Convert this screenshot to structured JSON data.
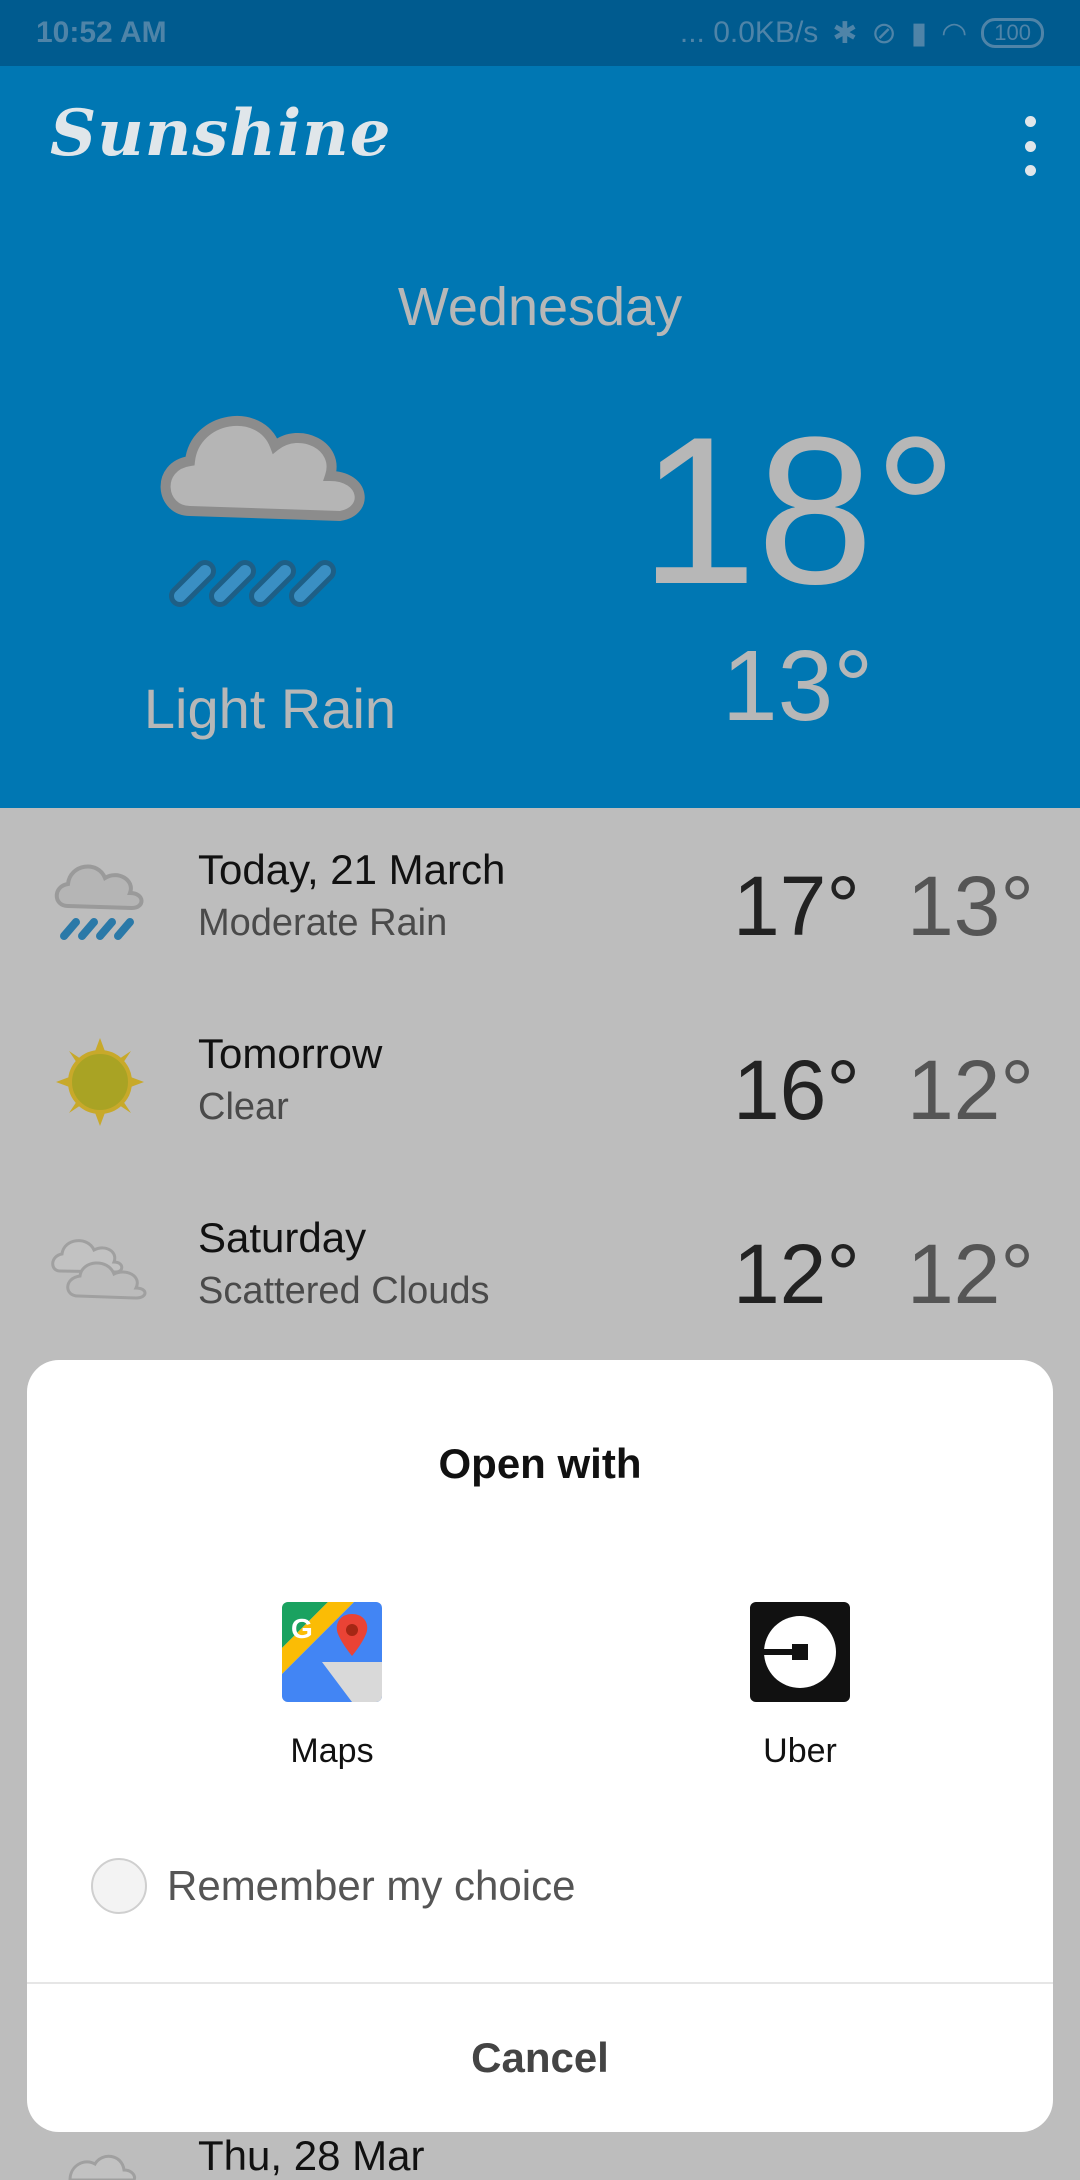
{
  "status_bar": {
    "time": "10:52 AM",
    "network": "... 0.0KB/s",
    "battery": "100"
  },
  "app": {
    "title": "Sunshine"
  },
  "today": {
    "day": "Wednesday",
    "condition": "Light Rain",
    "high": "18°",
    "low": "13°",
    "icon": "rain-cloud-icon"
  },
  "forecast": [
    {
      "date": "Today, 21 March",
      "desc": "Moderate Rain",
      "high": "17°",
      "low": "13°",
      "icon": "rain-cloud-icon"
    },
    {
      "date": "Tomorrow",
      "desc": "Clear",
      "high": "16°",
      "low": "12°",
      "icon": "sun-icon"
    },
    {
      "date": "Saturday",
      "desc": "Scattered Clouds",
      "high": "12°",
      "low": "12°",
      "icon": "clouds-icon"
    }
  ],
  "partial_row": {
    "date": "Thu, 28 Mar"
  },
  "dialog": {
    "title": "Open with",
    "apps": [
      {
        "label": "Maps",
        "icon": "maps-icon"
      },
      {
        "label": "Uber",
        "icon": "uber-icon"
      }
    ],
    "remember_label": "Remember my choice",
    "cancel_label": "Cancel"
  },
  "colors": {
    "primary": "#0077b3",
    "status_bar": "#005b8f",
    "scrim": "#bdbdbd"
  }
}
